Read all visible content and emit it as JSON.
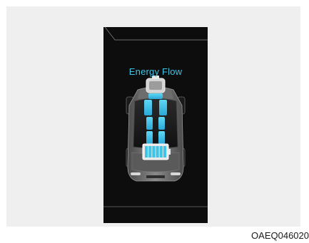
{
  "display": {
    "title": "Energy Flow",
    "battery_cells": 6
  },
  "caption": {
    "code": "OAEQ046020"
  },
  "colors": {
    "accent": "#40c4e6",
    "background": "#0d0d0d"
  },
  "icons": {
    "engine": "engine-icon",
    "vehicle": "vehicle-icon",
    "battery": "battery-icon"
  }
}
